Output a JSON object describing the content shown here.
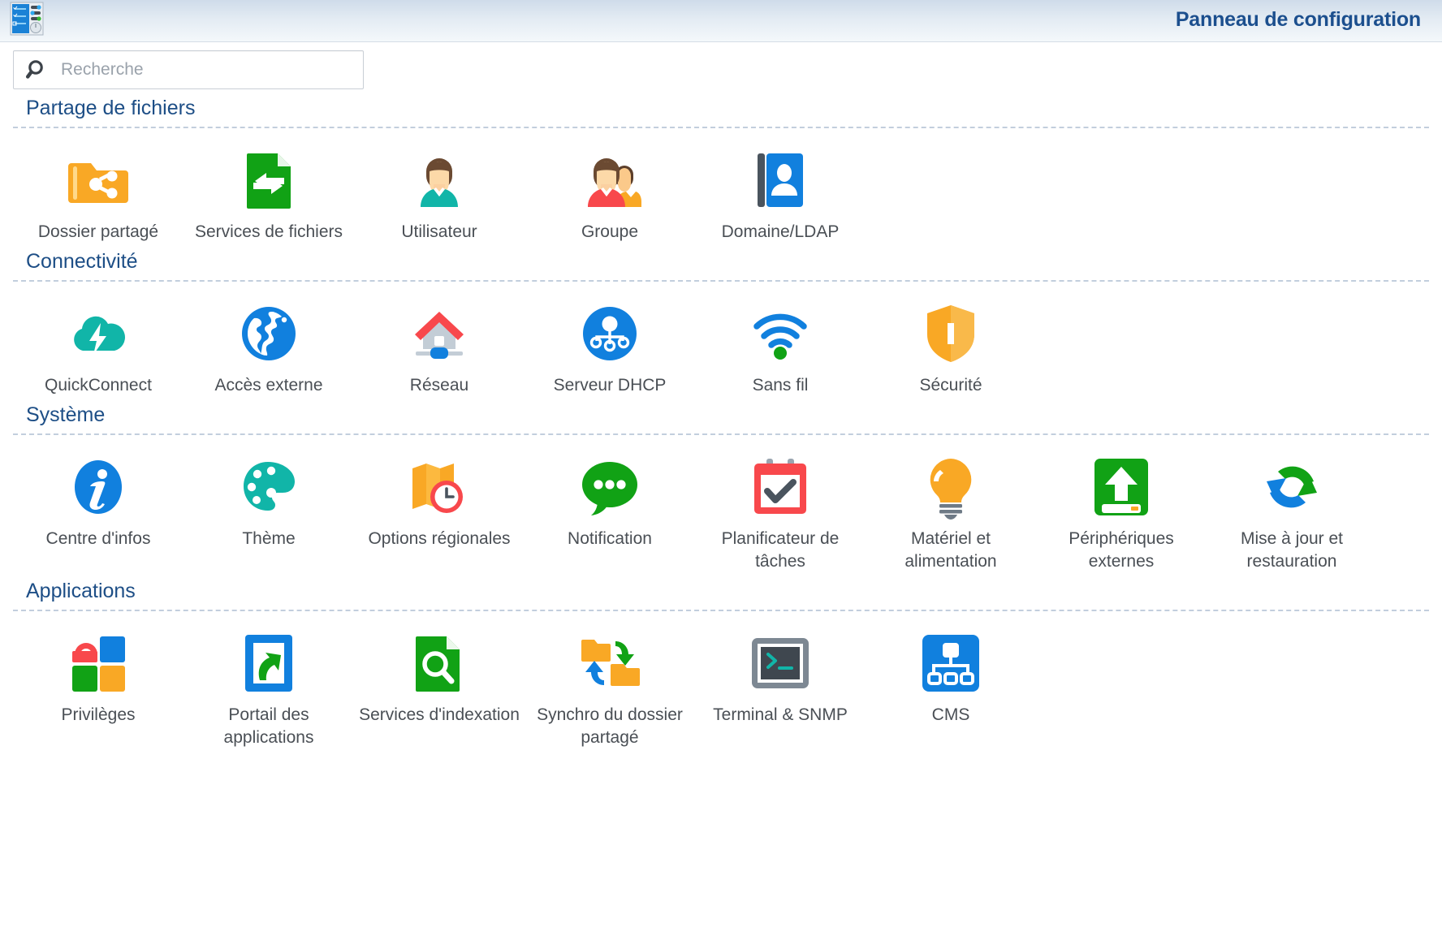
{
  "header": {
    "title": "Panneau de configuration",
    "logo_icon": "control-panel-logo-icon"
  },
  "search": {
    "placeholder": "Recherche",
    "value": "",
    "icon": "search-icon"
  },
  "sections": [
    {
      "title": "Partage de fichiers",
      "items": [
        {
          "label": "Dossier partagé",
          "icon": "shared-folder-icon"
        },
        {
          "label": "Services de fichiers",
          "icon": "file-services-icon"
        },
        {
          "label": "Utilisateur",
          "icon": "user-icon"
        },
        {
          "label": "Groupe",
          "icon": "group-icon"
        },
        {
          "label": "Domaine/LDAP",
          "icon": "domain-ldap-icon"
        }
      ]
    },
    {
      "title": "Connectivité",
      "items": [
        {
          "label": "QuickConnect",
          "icon": "quickconnect-cloud-icon"
        },
        {
          "label": "Accès externe",
          "icon": "external-access-globe-icon"
        },
        {
          "label": "Réseau",
          "icon": "network-house-icon"
        },
        {
          "label": "Serveur DHCP",
          "icon": "dhcp-server-icon"
        },
        {
          "label": "Sans fil",
          "icon": "wireless-wifi-icon"
        },
        {
          "label": "Sécurité",
          "icon": "security-shield-icon"
        }
      ]
    },
    {
      "title": "Système",
      "items": [
        {
          "label": "Centre d'infos",
          "icon": "info-center-icon"
        },
        {
          "label": "Thème",
          "icon": "theme-palette-icon"
        },
        {
          "label": "Options régionales",
          "icon": "regional-options-icon"
        },
        {
          "label": "Notification",
          "icon": "notification-bubble-icon"
        },
        {
          "label": "Planificateur de tâches",
          "icon": "task-scheduler-icon"
        },
        {
          "label": "Matériel et alimentation",
          "icon": "hardware-power-bulb-icon"
        },
        {
          "label": "Périphériques externes",
          "icon": "external-devices-icon"
        },
        {
          "label": "Mise à jour et restauration",
          "icon": "update-restore-icon"
        }
      ]
    },
    {
      "title": "Applications",
      "items": [
        {
          "label": "Privilèges",
          "icon": "privileges-lock-icon"
        },
        {
          "label": "Portail des applications",
          "icon": "application-portal-icon"
        },
        {
          "label": "Services d'indexation",
          "icon": "indexing-services-icon"
        },
        {
          "label": "Synchro du dossier partagé",
          "icon": "shared-folder-sync-icon"
        },
        {
          "label": "Terminal & SNMP",
          "icon": "terminal-snmp-icon"
        },
        {
          "label": "CMS",
          "icon": "cms-icon"
        }
      ]
    }
  ],
  "colors": {
    "title_blue": "#1c4f8e",
    "section_blue": "#1d4e86",
    "label_gray": "#4a4f55",
    "orange": "#f9a825",
    "green": "#11a215",
    "blue": "#1180de",
    "teal": "#11b5a8",
    "red": "#f9484c",
    "dark_slate": "#4a545e",
    "gray": "#c3cdd6"
  }
}
